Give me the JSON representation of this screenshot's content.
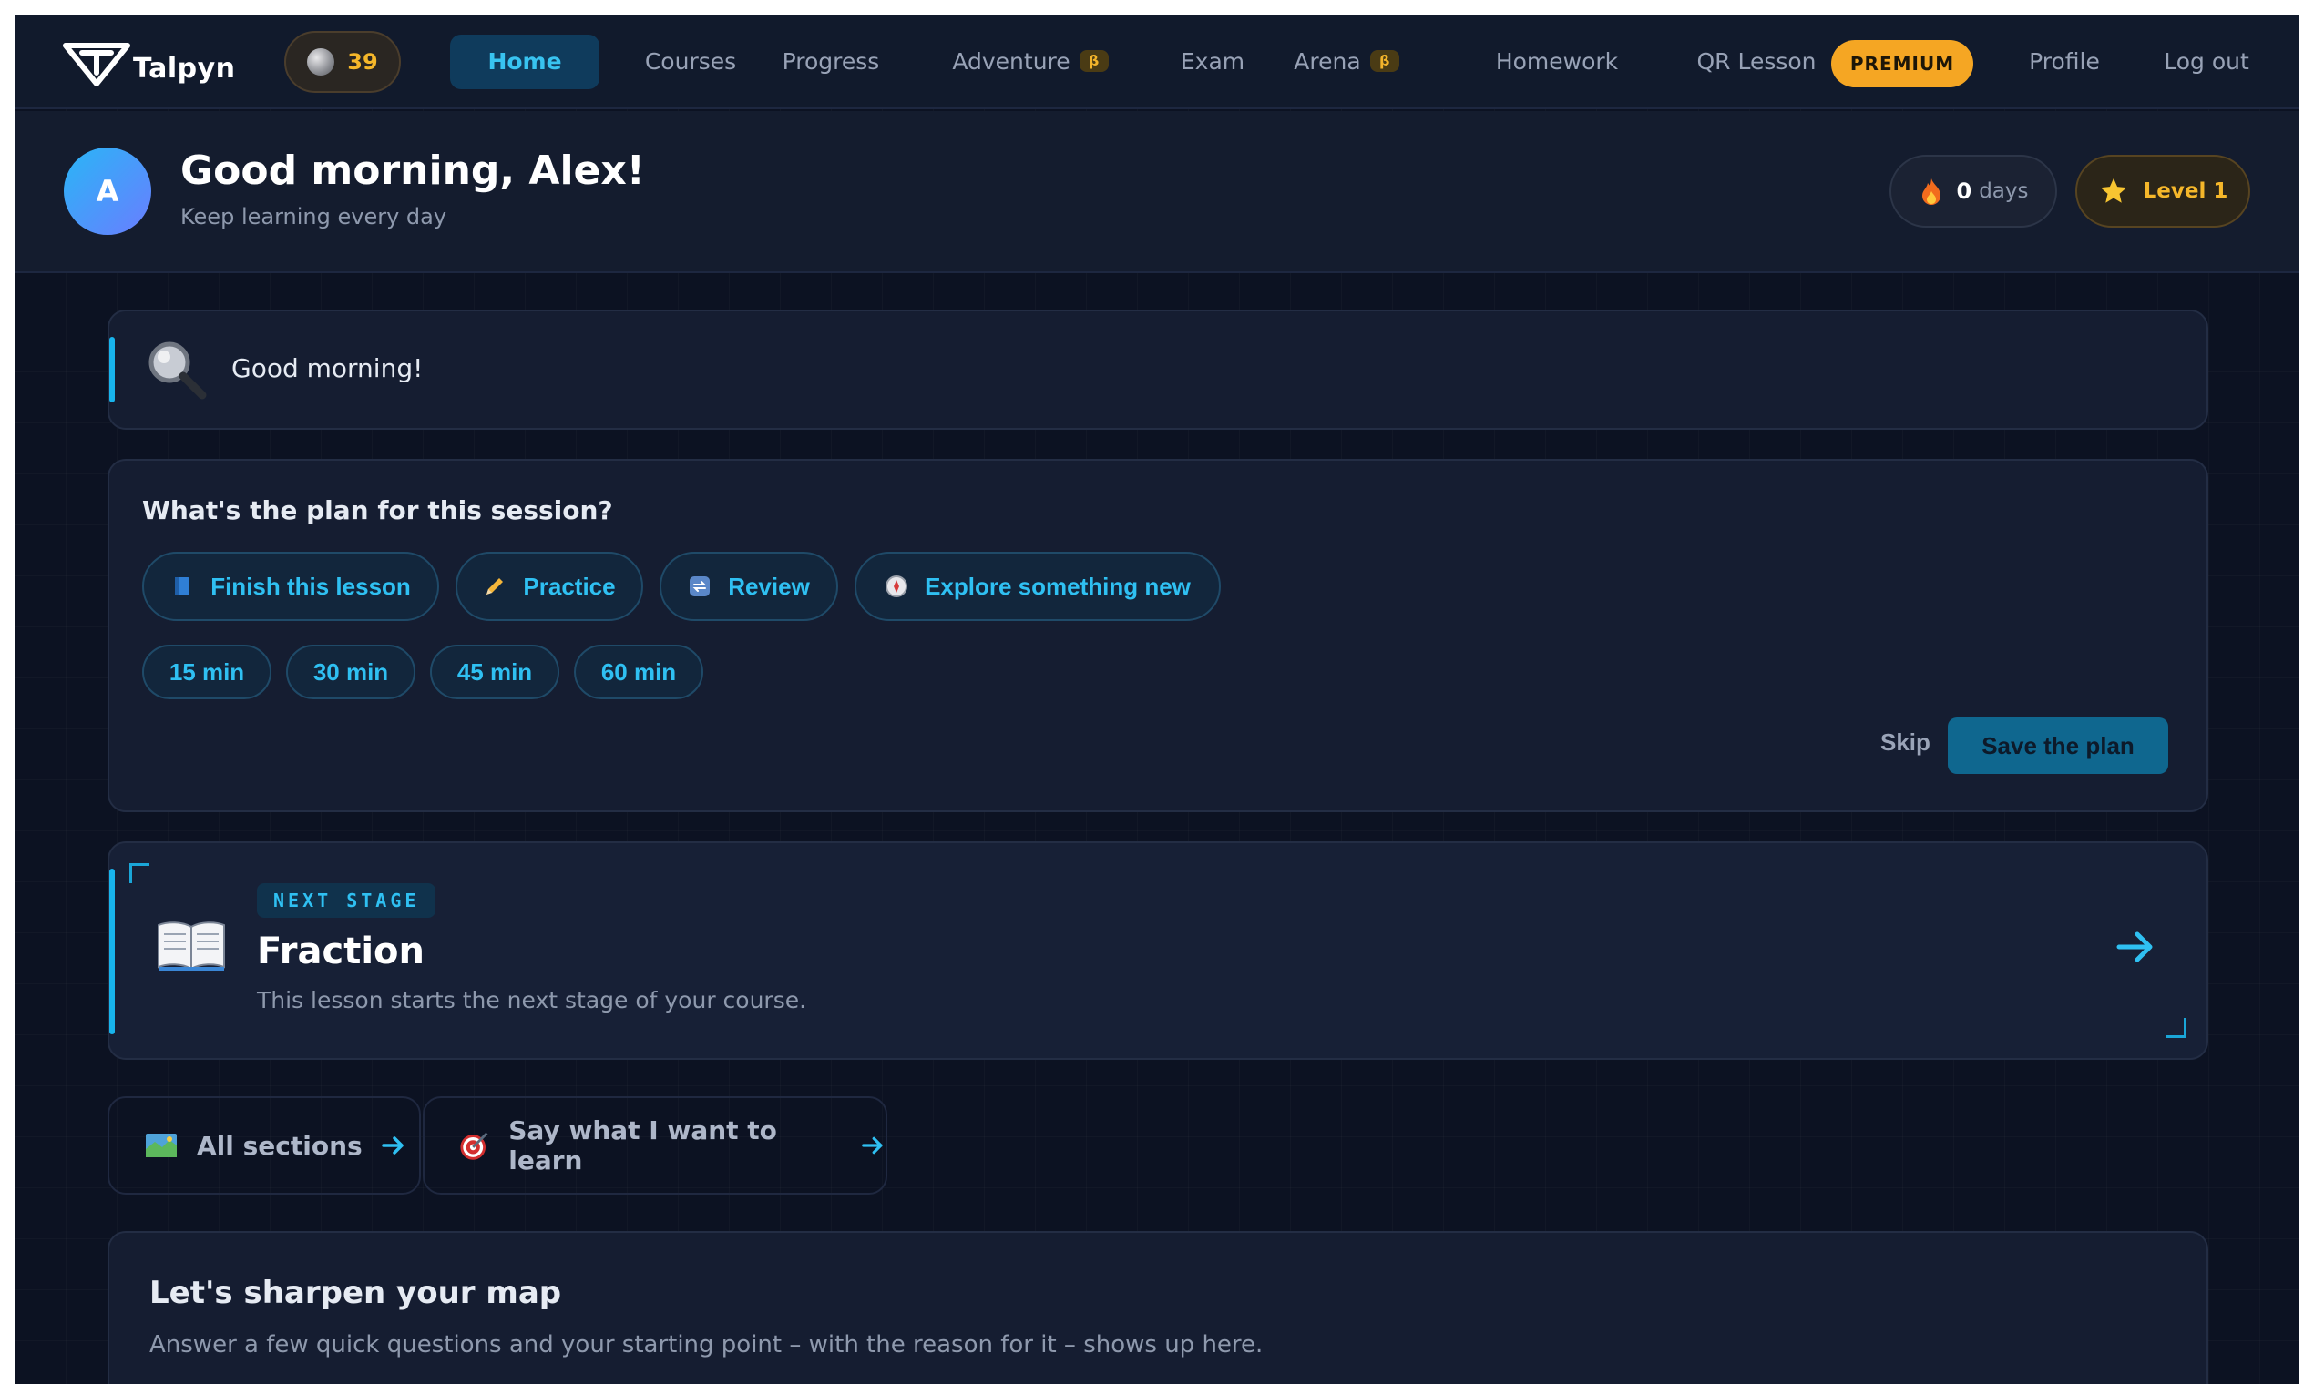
{
  "app": {
    "name": "Talpyn"
  },
  "nav": {
    "coins": "39",
    "items": [
      {
        "label": "Home",
        "active": true
      },
      {
        "label": "Courses"
      },
      {
        "label": "Progress"
      },
      {
        "label": "Adventure",
        "badge": "β"
      },
      {
        "label": "Exam"
      },
      {
        "label": "Arena",
        "badge": "β"
      },
      {
        "label": "Homework"
      },
      {
        "label": "QR Lesson"
      },
      {
        "label": "Profile"
      },
      {
        "label": "Log out"
      }
    ],
    "premium": "PREMIUM"
  },
  "header": {
    "avatar_initial": "A",
    "title": "Good morning, Alex!",
    "subtitle": "Keep learning every day",
    "streak_value": "0",
    "streak_unit": "days",
    "level": "Level 1"
  },
  "hello_card": {
    "text": "Good morning!"
  },
  "plan": {
    "question": "What's the plan for this session?",
    "goals": [
      {
        "label": "Finish this lesson",
        "icon": "book-icon"
      },
      {
        "label": "Practice",
        "icon": "pencil-icon"
      },
      {
        "label": "Review",
        "icon": "repeat-icon"
      },
      {
        "label": "Explore something new",
        "icon": "compass-icon"
      }
    ],
    "durations": [
      "15 min",
      "30 min",
      "45 min",
      "60 min"
    ],
    "skip": "Skip",
    "save": "Save the plan"
  },
  "next_stage": {
    "tag": "NEXT STAGE",
    "title": "Fraction",
    "description": "This lesson starts the next stage of your course."
  },
  "links": {
    "all_sections": "All sections",
    "say_what": "Say what I want to learn"
  },
  "map_card": {
    "title": "Let's sharpen your map",
    "subtitle": "Answer a few quick questions and your starting point – with the reason for it – shows up here."
  },
  "colors": {
    "background": "#0c1222",
    "accent": "#2fc0f2",
    "gold": "#f5b72a",
    "premium": "#f5a623"
  }
}
